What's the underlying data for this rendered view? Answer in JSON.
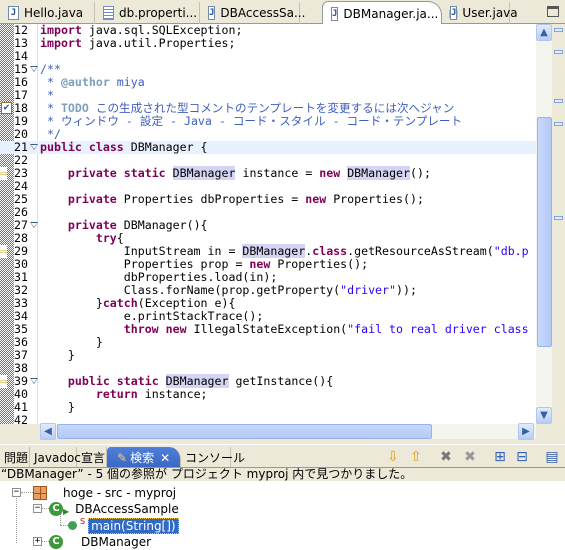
{
  "editor_tabs": [
    {
      "label": "Hello.java",
      "icon": "java-file-icon",
      "active": false
    },
    {
      "label": "db.properti...",
      "icon": "properties-file-icon",
      "active": false
    },
    {
      "label": "DBAccessSa...",
      "icon": "java-file-icon",
      "active": false
    },
    {
      "label": "DBManager.ja...",
      "icon": "java-file-icon",
      "active": true
    },
    {
      "label": "User.java",
      "icon": "java-file-icon",
      "active": false
    }
  ],
  "close_glyph": "⊠",
  "code": {
    "current_line": 21,
    "lines": [
      {
        "n": 12,
        "segs": [
          [
            "k",
            "import"
          ],
          [
            "n",
            " java.sql.SQLException;"
          ]
        ]
      },
      {
        "n": 13,
        "segs": [
          [
            "k",
            "import"
          ],
          [
            "n",
            " java.util.Properties;"
          ]
        ]
      },
      {
        "n": 14,
        "segs": []
      },
      {
        "n": 15,
        "fold": true,
        "segs": [
          [
            "c",
            "/**"
          ]
        ]
      },
      {
        "n": 16,
        "segs": [
          [
            "c",
            " * "
          ],
          [
            "t",
            "@author"
          ],
          [
            "c",
            " miya"
          ]
        ]
      },
      {
        "n": 17,
        "segs": [
          [
            "c",
            " *"
          ]
        ]
      },
      {
        "n": 18,
        "marker": "task",
        "segs": [
          [
            "c",
            " * "
          ],
          [
            "t",
            "TODO"
          ],
          [
            "c",
            " この生成された型コメントのテンプレートを変更するには次へジャン"
          ]
        ]
      },
      {
        "n": 19,
        "segs": [
          [
            "c",
            " * ウィンドウ - 設定 - Java - コード・スタイル - コード・テンプレート"
          ]
        ]
      },
      {
        "n": 20,
        "segs": [
          [
            "c",
            " */"
          ]
        ]
      },
      {
        "n": 21,
        "fold": true,
        "segs": [
          [
            "k",
            "public"
          ],
          [
            "n",
            " "
          ],
          [
            "k",
            "class"
          ],
          [
            "n",
            " DBManager {"
          ]
        ]
      },
      {
        "n": 22,
        "segs": []
      },
      {
        "n": 23,
        "marker": "arrow",
        "segs": [
          [
            "n",
            "    "
          ],
          [
            "k",
            "private"
          ],
          [
            "n",
            " "
          ],
          [
            "k",
            "static"
          ],
          [
            "n",
            " "
          ],
          [
            "h",
            "DBManager"
          ],
          [
            "n",
            " instance = "
          ],
          [
            "k",
            "new"
          ],
          [
            "n",
            " "
          ],
          [
            "h",
            "DBManager"
          ],
          [
            "n",
            "();"
          ]
        ]
      },
      {
        "n": 24,
        "segs": []
      },
      {
        "n": 25,
        "segs": [
          [
            "n",
            "    "
          ],
          [
            "k",
            "private"
          ],
          [
            "n",
            " Properties dbProperties = "
          ],
          [
            "k",
            "new"
          ],
          [
            "n",
            " Properties();"
          ]
        ]
      },
      {
        "n": 26,
        "segs": []
      },
      {
        "n": 27,
        "fold": true,
        "segs": [
          [
            "n",
            "    "
          ],
          [
            "k",
            "private"
          ],
          [
            "n",
            " DBManager(){"
          ]
        ]
      },
      {
        "n": 28,
        "segs": [
          [
            "n",
            "        "
          ],
          [
            "k",
            "try"
          ],
          [
            "n",
            "{"
          ]
        ]
      },
      {
        "n": 29,
        "marker": "arrow",
        "segs": [
          [
            "n",
            "            InputStream in = "
          ],
          [
            "h",
            "DBManager"
          ],
          [
            "n",
            "."
          ],
          [
            "k",
            "class"
          ],
          [
            "n",
            ".getResourceAsStream("
          ],
          [
            "s",
            "\"db.p"
          ]
        ]
      },
      {
        "n": 30,
        "segs": [
          [
            "n",
            "            Properties prop = "
          ],
          [
            "k",
            "new"
          ],
          [
            "n",
            " Properties();"
          ]
        ]
      },
      {
        "n": 31,
        "segs": [
          [
            "n",
            "            dbProperties.load(in);"
          ]
        ]
      },
      {
        "n": 32,
        "segs": [
          [
            "n",
            "            Class.forName(prop.getProperty("
          ],
          [
            "s",
            "\"driver\""
          ],
          [
            "n",
            "));"
          ]
        ]
      },
      {
        "n": 33,
        "segs": [
          [
            "n",
            "        }"
          ],
          [
            "k",
            "catch"
          ],
          [
            "n",
            "(Exception e){"
          ]
        ]
      },
      {
        "n": 34,
        "segs": [
          [
            "n",
            "            e.printStackTrace();"
          ]
        ]
      },
      {
        "n": 35,
        "segs": [
          [
            "n",
            "            "
          ],
          [
            "k",
            "throw"
          ],
          [
            "n",
            " "
          ],
          [
            "k",
            "new"
          ],
          [
            "n",
            " IllegalStateException("
          ],
          [
            "s",
            "\"fail to real driver class"
          ]
        ]
      },
      {
        "n": 36,
        "segs": [
          [
            "n",
            "        }"
          ]
        ]
      },
      {
        "n": 37,
        "segs": [
          [
            "n",
            "    }"
          ]
        ]
      },
      {
        "n": 38,
        "segs": []
      },
      {
        "n": 39,
        "fold": true,
        "marker": "arrow",
        "segs": [
          [
            "n",
            "    "
          ],
          [
            "k",
            "public"
          ],
          [
            "n",
            " "
          ],
          [
            "k",
            "static"
          ],
          [
            "n",
            " "
          ],
          [
            "h",
            "DBManager"
          ],
          [
            "n",
            " getInstance(){"
          ]
        ]
      },
      {
        "n": 40,
        "segs": [
          [
            "n",
            "        "
          ],
          [
            "k",
            "return"
          ],
          [
            "n",
            " instance;"
          ]
        ]
      },
      {
        "n": 41,
        "segs": [
          [
            "n",
            "    }"
          ]
        ]
      },
      {
        "n": 42,
        "segs": []
      }
    ]
  },
  "panel": {
    "tabs": [
      {
        "label": "問題",
        "active": false
      },
      {
        "label": "Javadoc",
        "active": false
      },
      {
        "label": "宣言",
        "active": false
      },
      {
        "label": "検索",
        "active": true,
        "close": "✕"
      },
      {
        "label": "コンソール",
        "active": false
      }
    ],
    "toolbar": [
      "next-match-icon",
      "previous-match-icon",
      "remove-match-icon",
      "remove-all-matches-icon",
      "expand-all-icon",
      "collapse-all-icon",
      "search-history-icon"
    ],
    "status": "“DBManager” - 5 個の参照が プロジェクト myproj 内で見つかりました。",
    "tree": {
      "package": "hoge - src - myproj",
      "class1": "DBAccessSample",
      "method": "main(String[])",
      "static_mark": "S",
      "class2": "DBManager"
    }
  },
  "colors": {
    "keyword": "#7f0055",
    "comment": "#3f5fbf",
    "string": "#2a00ff",
    "occurrence": "#d4d4f4",
    "current_line": "#e8f2fe",
    "selection": "#316ac5"
  }
}
